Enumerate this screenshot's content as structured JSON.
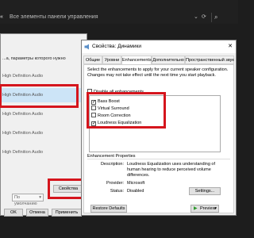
{
  "topbar": {
    "back_glyph": "«",
    "breadcrumb": "Все элементы панели управления",
    "dropdown_glyph": "⌄",
    "refresh_glyph": "⟳",
    "search_glyph": "⌕"
  },
  "sound_dialog": {
    "hint": "...а, параметры которого нужно",
    "devices": [
      "High Definition Audio",
      "High Definition Audio",
      "High Definition Audio",
      "High Definition Audio",
      "High Definition Audio"
    ],
    "selected_index": 1,
    "default_combo": "По умолчанию",
    "properties_button": "Свойства",
    "ok_button": "OK",
    "cancel_button": "Отмена",
    "apply_button": "Применить"
  },
  "props_dialog": {
    "title": "Свойства: Динамики",
    "close_glyph": "✕",
    "tabs": [
      "Общие",
      "Уровни",
      "Enhancements",
      "Дополнительно",
      "Пространственный звук"
    ],
    "active_tab": "Enhancements",
    "description": "Select the enhancements to apply for your current speaker configuration. Changes may not take effect until the next time you start playback.",
    "disable_all": "Disable all enhancements",
    "enhancements": [
      {
        "label": "Bass Boost",
        "checked": true
      },
      {
        "label": "Virtual Surround",
        "checked": false
      },
      {
        "label": "Room Correction",
        "checked": false
      },
      {
        "label": "Loudness Equalization",
        "checked": true
      }
    ],
    "properties_header": "Enhancement Properties",
    "description_label": "Description:",
    "description_value": "Loudness Equalization uses understanding of human hearing to reduce perceived volume differences.",
    "provider_label": "Provider:",
    "provider_value": "Microsoft",
    "status_label": "Status:",
    "status_value": "Disabled",
    "settings_button": "Settings...",
    "restore_button": "Restore Defaults",
    "preview_button": "Preview",
    "checkmark_glyph": "✓",
    "preview_play_glyph": "▶",
    "preview_dropdown_glyph": "▾"
  },
  "colors": {
    "highlight_red": "#d5151d",
    "selected_row": "#cce4f7",
    "dark_bg": "#1d1d1d"
  }
}
